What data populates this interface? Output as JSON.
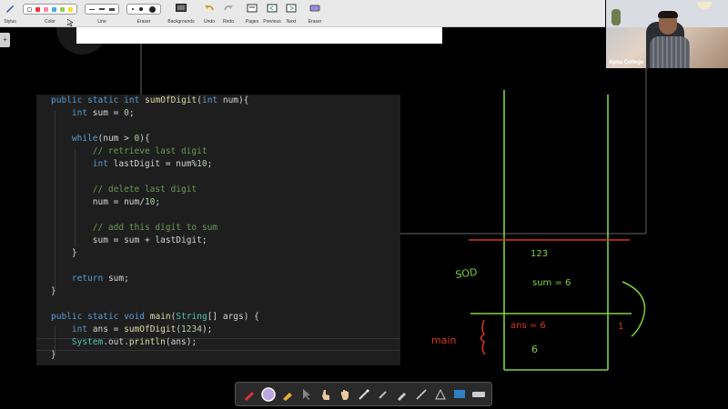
{
  "toolbar": {
    "stylus": "Stylus",
    "color": "Color",
    "line": "Line",
    "eraser": "Eraser",
    "backgrounds": "Backgrounds",
    "undo": "Undo",
    "redo": "Redo",
    "pages": "Pages",
    "previous": "Previous",
    "next": "Next",
    "eraser2": "Eraser"
  },
  "webcam": {
    "label": "Apna College"
  },
  "code_lines": [
    "public static int sumOfDigit(int num){",
    "    int sum = 0;",
    "",
    "    while(num > 0){",
    "        // retrieve last digit",
    "        int lastDigit = num%10;",
    "",
    "        // delete last digit",
    "        num = num/10;",
    "",
    "        // add this digit to sum",
    "        sum = sum + lastDigit;",
    "    }",
    "",
    "    return sum;",
    "}",
    "",
    "public static void main(String[] args) {",
    "    int ans = sumOfDigit(1234);",
    "    System.out.println(ans);",
    "}"
  ],
  "annotations": {
    "stack_top_value": "123",
    "sod_label": "SOD",
    "sum_label": "sum = 6",
    "main_label": "main",
    "ans_label": "ans = 6",
    "six_label": "6",
    "one_label": "1"
  },
  "colors": {
    "keyword": "#569cd6",
    "function": "#dcdcaa",
    "comment": "#6a9955",
    "number": "#b5cea8",
    "type": "#4ec9b0",
    "ink_green": "#7fd23a",
    "ink_red": "#d8351f"
  }
}
